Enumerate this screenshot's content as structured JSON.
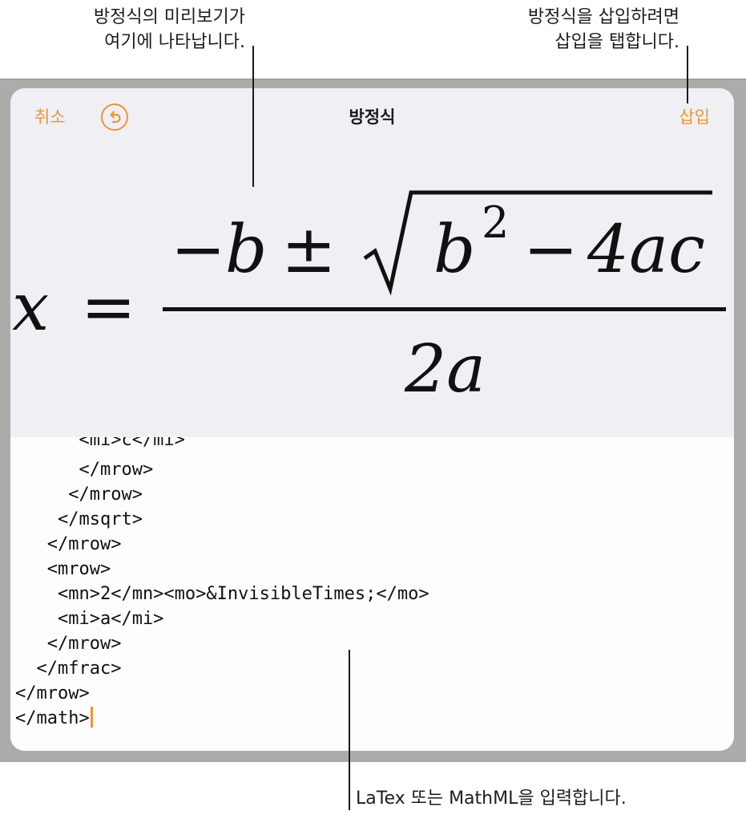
{
  "callouts": {
    "preview_line1": "방정식의 미리보기가",
    "preview_line2": "여기에 나타납니다.",
    "insert_line1": "방정식을 삽입하려면",
    "insert_line2": "삽입을 탭합니다.",
    "input": "LaTex 또는 MathML을 입력합니다."
  },
  "dialog": {
    "title": "방정식",
    "cancel_label": "취소",
    "insert_label": "삽입",
    "undo_icon": "undo-arrow-circle-icon"
  },
  "formula": {
    "lhs": "x",
    "equals": "=",
    "minus": "−",
    "b": "b",
    "plus_minus": "±",
    "b2": "b",
    "exponent": "2",
    "minus2": "−",
    "four_ac": "4ac",
    "denominator": "2a"
  },
  "editor": {
    "lines": [
      "      <mi>c</mi>",
      "      </mrow>",
      "     </mrow>",
      "    </msqrt>",
      "   </mrow>",
      "   <mrow>",
      "    <mn>2</mn><mo>&InvisibleTimes;</mo>",
      "    <mi>a</mi>",
      "   </mrow>",
      "  </mfrac>",
      "</mrow>",
      "</math>"
    ]
  },
  "colors": {
    "accent": "#e8963a",
    "preview_background": "#efeff4",
    "frame": "#a9aca9"
  }
}
